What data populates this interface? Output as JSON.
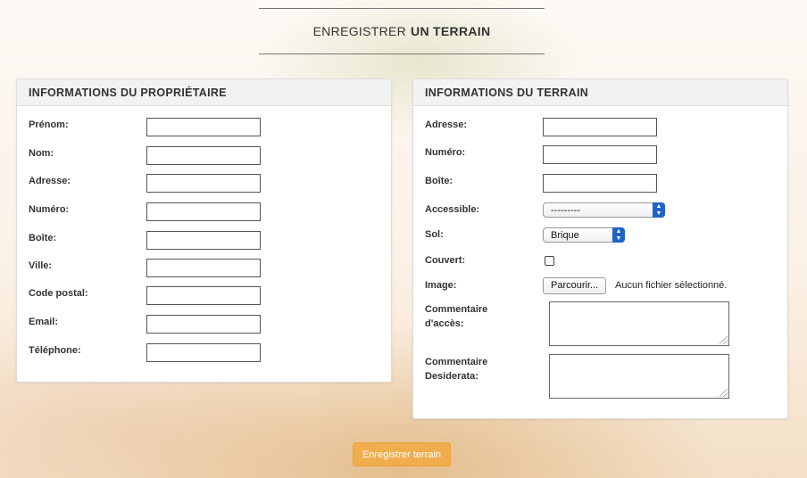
{
  "page_title": {
    "normal": "ENREGISTRER",
    "bold": "UN TERRAIN"
  },
  "owner": {
    "heading": "INFORMATIONS DU PROPRIÉTAIRE",
    "fields": [
      {
        "label": "Prénom:",
        "value": ""
      },
      {
        "label": "Nom:",
        "value": ""
      },
      {
        "label": "Adresse:",
        "value": ""
      },
      {
        "label": "Numéro:",
        "value": ""
      },
      {
        "label": "Boîte:",
        "value": ""
      },
      {
        "label": "Ville:",
        "value": ""
      },
      {
        "label": "Code postal:",
        "value": ""
      },
      {
        "label": "Email:",
        "value": ""
      },
      {
        "label": "Téléphone:",
        "value": ""
      }
    ]
  },
  "terrain": {
    "heading": "INFORMATIONS DU TERRAIN",
    "adresse": {
      "label": "Adresse:",
      "value": ""
    },
    "numero": {
      "label": "Numéro:",
      "value": ""
    },
    "boite": {
      "label": "Boîte:",
      "value": ""
    },
    "accessible": {
      "label": "Accessible:",
      "selected": "---------"
    },
    "sol": {
      "label": "Sol:",
      "selected": "Brique"
    },
    "couvert": {
      "label": "Couvert:",
      "checked": false
    },
    "image": {
      "label": "Image:",
      "button": "Parcourir...",
      "status": "Aucun fichier sélectionné."
    },
    "commentaire_acces": {
      "label_line1": "Commentaire",
      "label_line2": "d'accès:",
      "value": ""
    },
    "commentaire_desiderata": {
      "label_line1": "Commentaire",
      "label_line2": "Desiderata:",
      "value": ""
    }
  },
  "submit_label": "Enregistrer terrain",
  "colors": {
    "accent": "#f0ad4e",
    "select_arrow": "#1f63c8"
  }
}
